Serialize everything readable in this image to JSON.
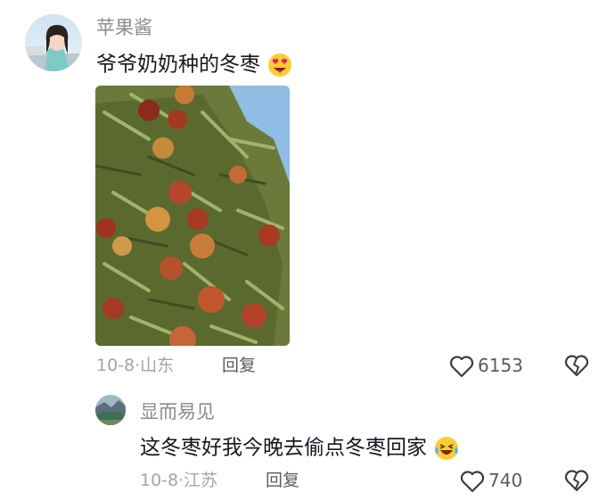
{
  "comments": [
    {
      "username": "苹果酱",
      "text": "爷爷奶奶种的冬枣",
      "emoji_icon": "heart-eyes-emoji",
      "image_desc_icon": "jujube-tree-photo",
      "date": "10-8",
      "location": "山东",
      "reply_label": "回复",
      "like_count": "6153"
    },
    {
      "username": "显而易见",
      "text": "这冬枣好我今晚去偷点冬枣回家",
      "emoji_icon": "laughing-crying-emoji",
      "date": "10-8",
      "location": "江苏",
      "reply_label": "回复",
      "like_count": "740"
    }
  ],
  "meta_separator": "·",
  "colors": {
    "username": "#8a8b91",
    "meta": "#a3a4a9",
    "text": "#161823"
  }
}
